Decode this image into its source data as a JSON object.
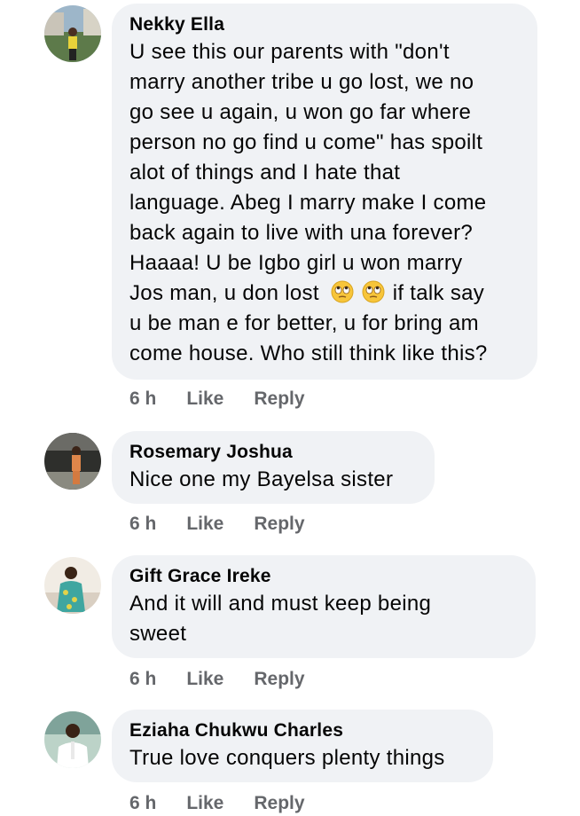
{
  "comments": [
    {
      "author": "Nekky Ella",
      "text_lines": [
        "U see this our parents with \"don't",
        "marry another tribe u go lost, we no",
        "go see u again, u won go far where",
        "person no go find u come\" has spoilt",
        "alot of things and I hate that",
        "language. Abeg I marry make I come",
        "back again to live with una forever?",
        "Haaaa! U be Igbo girl u won marry",
        "Jos man, u don lost",
        " if talk say",
        "u be man e for better, u for bring am",
        "come house. Who still think like this?"
      ],
      "time": "6 h",
      "like": "Like",
      "reply": "Reply"
    },
    {
      "author": "Rosemary Joshua",
      "text": "Nice one my Bayelsa sister",
      "time": "6 h",
      "like": "Like",
      "reply": "Reply"
    },
    {
      "author": "Gift Grace Ireke",
      "text_lines": [
        "And it will and must keep being",
        "sweet"
      ],
      "time": "6 h",
      "like": "Like",
      "reply": "Reply"
    },
    {
      "author": "Eziaha Chukwu Charles",
      "text": "True love conquers plenty things",
      "time": "6 h",
      "like": "Like",
      "reply": "Reply"
    }
  ],
  "icons": {
    "emoji": "face-with-rolling-eyes-icon"
  }
}
